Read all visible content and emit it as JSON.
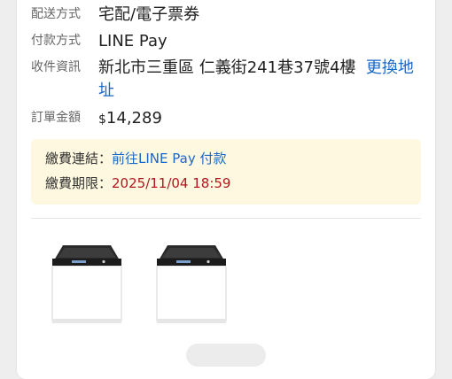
{
  "order": {
    "shipping": {
      "label": "配送方式",
      "value": "宅配/電子票券"
    },
    "payment": {
      "label": "付款方式",
      "value": "LINE Pay"
    },
    "recipient": {
      "label": "收件資訊",
      "address": "新北市三重區 仁義街241巷37號4樓",
      "change_link": "更換地址"
    },
    "total": {
      "label": "訂單金額",
      "currency": "$",
      "amount": "14,289"
    }
  },
  "payment_notice": {
    "link_label": "繳費連結：",
    "link_text": "前往LINE Pay 付款",
    "deadline_label": "繳費期限：",
    "deadline_value": "2025/11/04 18:59"
  },
  "products": [
    {
      "icon": "washing-machine-icon"
    },
    {
      "icon": "washing-machine-icon"
    }
  ],
  "colors": {
    "link": "#1b67c7",
    "deadline": "#b01820",
    "notice_bg": "#fdf8df"
  }
}
